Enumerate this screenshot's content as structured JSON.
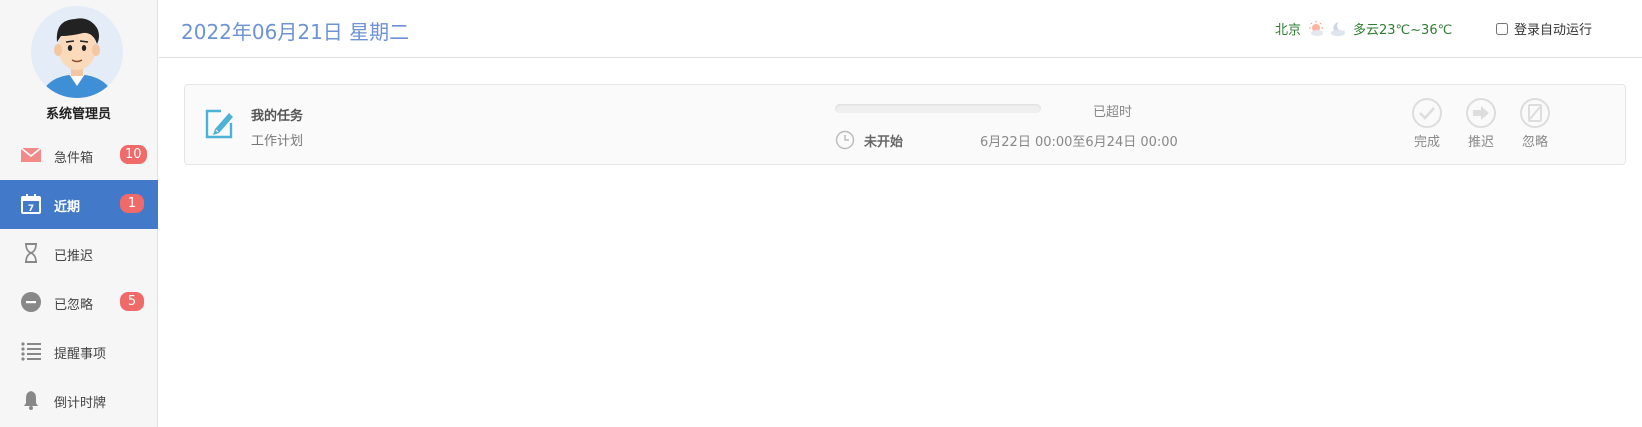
{
  "user": {
    "name": "系统管理员"
  },
  "sidebar": {
    "items": [
      {
        "label": "急件箱",
        "icon": "envelope-icon",
        "badge": "10",
        "active": false
      },
      {
        "label": "近期",
        "icon": "calendar-icon",
        "badge": "1",
        "active": true
      },
      {
        "label": "已推迟",
        "icon": "hourglass-icon",
        "badge": null,
        "active": false
      },
      {
        "label": "已忽略",
        "icon": "minus-circle-icon",
        "badge": "5",
        "active": false
      },
      {
        "label": "提醒事项",
        "icon": "list-icon",
        "badge": null,
        "active": false
      },
      {
        "label": "倒计时牌",
        "icon": "bell-icon",
        "badge": null,
        "active": false
      }
    ]
  },
  "header": {
    "date": "2022年06月21日 星期二",
    "weather": {
      "city": "北京",
      "condition_icons": [
        "sun-cloud-icon",
        "moon-cloud-icon"
      ],
      "text": "多云23℃~36℃"
    },
    "autorun_label": "登录自动运行",
    "autorun_checked": false
  },
  "task": {
    "title": "我的任务",
    "subtitle": "工作计划",
    "progress": 0,
    "overdue_label": "已超时",
    "status": "未开始",
    "time_range": "6月22日 00:00至6月24日 00:00",
    "actions": [
      {
        "label": "完成",
        "icon": "check-circle-icon"
      },
      {
        "label": "推迟",
        "icon": "arrow-right-circle-icon"
      },
      {
        "label": "忽略",
        "icon": "ignore-circle-icon"
      }
    ]
  },
  "colors": {
    "accent": "#4279c8",
    "badge": "#f06a6a",
    "date_text": "#6d93d4",
    "weather_text": "#2e7d32"
  }
}
